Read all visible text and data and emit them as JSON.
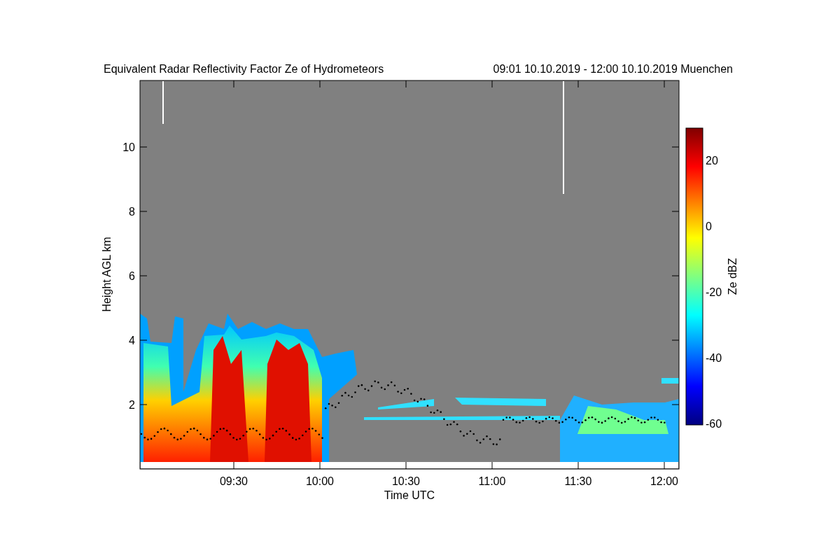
{
  "title": "Equivalent Radar Reflectivity Factor Ze of Hydrometeors",
  "period": "09:01 10.10.2019 - 12:00 10.10.2019 Muenchen",
  "plot": {
    "xlabel": "Time UTC",
    "ylabel": "Height AGL km",
    "xticks": [
      "09:30",
      "10:00",
      "10:30",
      "11:00",
      "11:30",
      "12:00"
    ],
    "yticks": [
      "10",
      "8",
      "6",
      "4",
      "2"
    ]
  },
  "colorbar": {
    "label": "Ze dBZ",
    "ticks": [
      "20",
      "0",
      "-20",
      "-40",
      "-60"
    ]
  }
}
